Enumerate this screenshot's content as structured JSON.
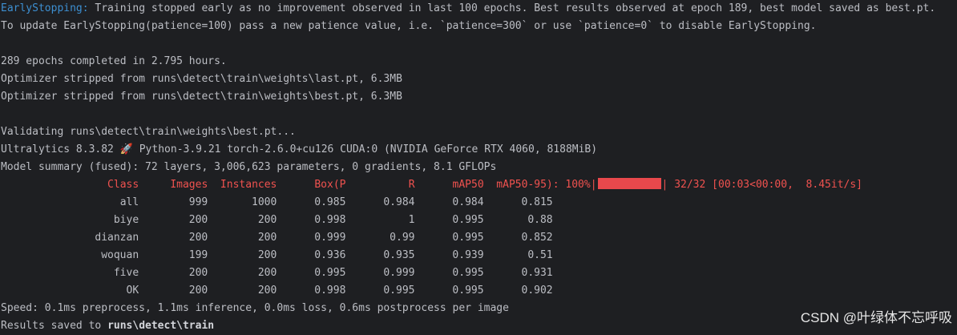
{
  "header": {
    "es_label": "EarlyStopping:",
    "es_msg": " Training stopped early as no improvement observed in last 100 epochs. Best results observed at epoch 189, best model saved as best.pt.",
    "es_hint": "To update EarlyStopping(patience=100) pass a new patience value, i.e. `patience=300` or use `patience=0` to disable EarlyStopping."
  },
  "summary": {
    "epochs": "289 epochs completed in 2.795 hours.",
    "strip_last": "Optimizer stripped from runs\\detect\\train\\weights\\last.pt, 6.3MB",
    "strip_best": "Optimizer stripped from runs\\detect\\train\\weights\\best.pt, 6.3MB"
  },
  "validation": {
    "validating": "Validating runs\\detect\\train\\weights\\best.pt...",
    "env_prefix": "Ultralytics 8.3.82 ",
    "rocket": "🚀",
    "env_suffix": " Python-3.9.21 torch-2.6.0+cu126 CUDA:0 (NVIDIA GeForce RTX 4060, 8188MiB)",
    "model_summary": "Model summary (fused): 72 layers, 3,006,623 parameters, 0 gradients, 8.1 GFLOPs"
  },
  "table": {
    "header_cols": "                 Class     Images  Instances      Box(P          R      mAP50  mAP50-95): 100%|",
    "progress_fraction": 1.0,
    "progress_tail": "| 32/32 [00:03<00:00,  8.45it/s]",
    "rows": [
      {
        "cls": "all",
        "images": "999",
        "instances": "1000",
        "p": "0.985",
        "r": "0.984",
        "map50": "0.984",
        "map5095": "0.815"
      },
      {
        "cls": "biye",
        "images": "200",
        "instances": "200",
        "p": "0.998",
        "r": "1",
        "map50": "0.995",
        "map5095": "0.88"
      },
      {
        "cls": "dianzan",
        "images": "200",
        "instances": "200",
        "p": "0.999",
        "r": "0.99",
        "map50": "0.995",
        "map5095": "0.852"
      },
      {
        "cls": "woquan",
        "images": "199",
        "instances": "200",
        "p": "0.936",
        "r": "0.935",
        "map50": "0.939",
        "map5095": "0.51"
      },
      {
        "cls": "five",
        "images": "200",
        "instances": "200",
        "p": "0.995",
        "r": "0.999",
        "map50": "0.995",
        "map5095": "0.931"
      },
      {
        "cls": "OK",
        "images": "200",
        "instances": "200",
        "p": "0.998",
        "r": "0.995",
        "map50": "0.995",
        "map5095": "0.902"
      }
    ]
  },
  "footer": {
    "speed": "Speed: 0.1ms preprocess, 1.1ms inference, 0.0ms loss, 0.6ms postprocess per image",
    "results_prefix": "Results saved to ",
    "results_path": "runs\\detect\\train"
  },
  "watermark": "CSDN @叶绿体不忘呼吸",
  "colors": {
    "background": "#1e1f22",
    "text": "#bcbec4",
    "accent_blue": "#3d8fd1",
    "accent_red": "#f0524f"
  }
}
